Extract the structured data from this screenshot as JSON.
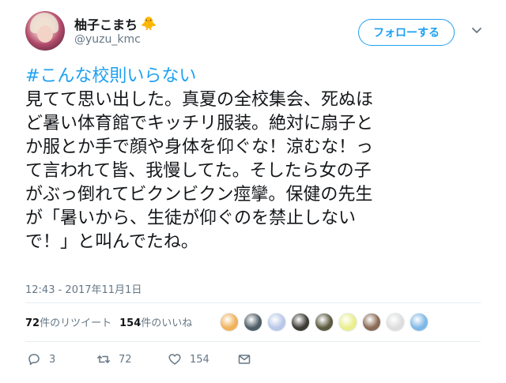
{
  "user": {
    "display_name": "柚子こまち",
    "name_emoji": "🐥",
    "handle": "@yuzu_kmc"
  },
  "follow_button_label": "フォローする",
  "tweet": {
    "hashtag": "#こんな校則いらない",
    "lines": [
      "見てて思い出した。真夏の全校集会、死ぬほ",
      "ど暑い体育館でキッチリ服装。絶対に扇子と",
      "か服とか手で顔や身体を仰ぐな！涼むな！っ",
      "て言われて皆、我慢してた。そしたら女の子",
      "がぶっ倒れてビクンビクン痙攣。保健の先生",
      "が「暑いから、生徒が仰ぐのを禁止しない",
      "で！」と叫んでたね。"
    ],
    "timestamp": "12:43 - 2017年11月1日"
  },
  "stats": {
    "retweets_count": "72",
    "retweets_label": "件のリツイート",
    "likes_count": "154",
    "likes_label": "件のいいね"
  },
  "liker_avatar_colors": [
    "#f0b25a",
    "#4f5d66",
    "#b9c7e8",
    "#3d3b34",
    "#5b5a3e",
    "#e9ef8c",
    "#8a6a55",
    "#dddddd",
    "#7fb8e6"
  ],
  "actions": {
    "reply_count": "3",
    "retweet_count": "72",
    "like_count": "154"
  },
  "colors": {
    "accent": "#1da1f2",
    "text": "#14171a",
    "muted": "#657786"
  }
}
